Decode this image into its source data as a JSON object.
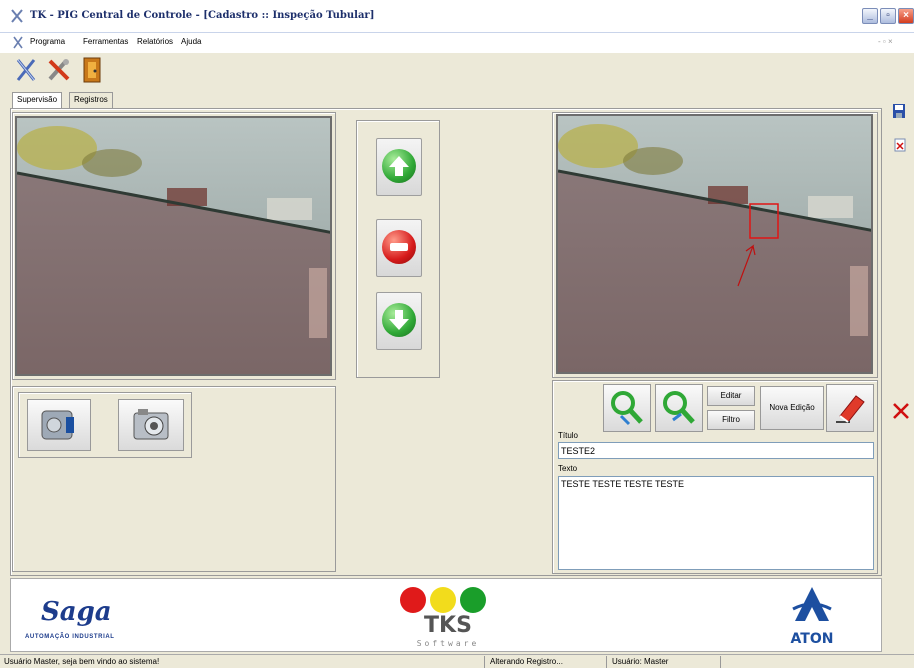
{
  "window": {
    "title": "TK - PIG Central de Controle - [Cadastro :: Inspeção Tubular]"
  },
  "menu": [
    "Programa",
    "Ferramentas",
    "Relatórios",
    "Ajuda"
  ],
  "tabs": [
    "Supervisão",
    "Registros"
  ],
  "edit": {
    "editar_label": "Editar",
    "filtro_label": "Filtro",
    "nova_edicao_label": "Nova Edição",
    "titulo_label": "Título",
    "titulo_value": "TESTE2",
    "texto_label": "Texto",
    "texto_value": "TESTE TESTE TESTE TESTE"
  },
  "logos": {
    "saga_name": "Saga",
    "saga_tagline": "AUTOMAÇÃO INDUSTRIAL",
    "tks_name": "TKS",
    "tks_sub": "Software",
    "aton_name": "ATON"
  },
  "status": {
    "welcome": "Usuário Master, seja bem vindo ao sistema!",
    "action": "Alterando Registro...",
    "user": "Usuário: Master"
  },
  "colors": {
    "up": "#2fa836",
    "stop": "#d61a1a",
    "down": "#2fa836",
    "close_x": "#d01010"
  }
}
